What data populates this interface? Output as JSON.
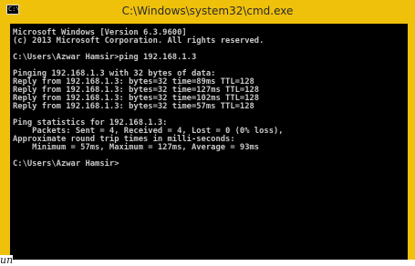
{
  "window": {
    "title": "C:\\Windows\\system32\\cmd.exe",
    "icon": "cmd-icon",
    "icon_glyph": "C:\\",
    "accent": "#f0c10b"
  },
  "console": {
    "lines": [
      "Microsoft Windows [Version 6.3.9600]",
      "(c) 2013 Microsoft Corporation. All rights reserved.",
      "",
      "C:\\Users\\Azwar Hamsir>ping 192.168.1.3",
      "",
      "Pinging 192.168.1.3 with 32 bytes of data:",
      "Reply from 192.168.1.3: bytes=32 time=89ms TTL=128",
      "Reply from 192.168.1.3: bytes=32 time=127ms TTL=128",
      "Reply from 192.168.1.3: bytes=32 time=102ms TTL=128",
      "Reply from 192.168.1.3: bytes=32 time=57ms TTL=128",
      "",
      "Ping statistics for 192.168.1.3:",
      "    Packets: Sent = 4, Received = 4, Lost = 0 (0% loss),",
      "Approximate round trip times in milli-seconds:",
      "    Minimum = 57ms, Maximum = 127ms, Average = 93ms",
      "",
      "C:\\Users\\Azwar Hamsir>"
    ]
  },
  "caption": "un"
}
